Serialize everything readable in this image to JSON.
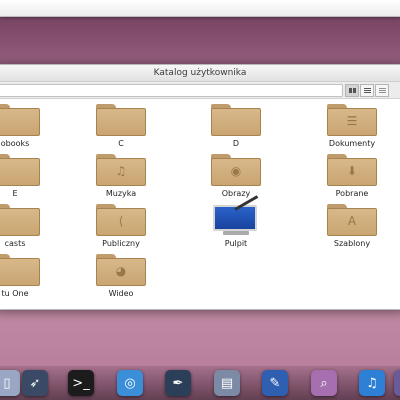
{
  "window": {
    "title": "Katalog użytkownika"
  },
  "folders": [
    {
      "label": "obooks",
      "emblem": ""
    },
    {
      "label": "C",
      "emblem": ""
    },
    {
      "label": "D",
      "emblem": ""
    },
    {
      "label": "Dokumenty",
      "emblem": "☰"
    },
    {
      "label": "E",
      "emblem": ""
    },
    {
      "label": "Muzyka",
      "emblem": "♫"
    },
    {
      "label": "Obrazy",
      "emblem": "◉"
    },
    {
      "label": "Pobrane",
      "emblem": "⬇"
    },
    {
      "label": "casts",
      "emblem": ""
    },
    {
      "label": "Publiczny",
      "emblem": "⟨"
    },
    {
      "label": "Pulpit",
      "emblem": ""
    },
    {
      "label": "Szablony",
      "emblem": "A"
    },
    {
      "label": "tu One",
      "emblem": ""
    },
    {
      "label": "Wideo",
      "emblem": "◕"
    }
  ],
  "dock": [
    {
      "name": "file-icon",
      "glyph": "▯",
      "color": "#9aa7c4"
    },
    {
      "name": "rocket-icon",
      "glyph": "➶",
      "color": "#3a4a66"
    },
    {
      "name": "terminal-icon",
      "glyph": ">_",
      "color": "#1c1c1c"
    },
    {
      "name": "network-icon",
      "glyph": "◎",
      "color": "#3a8fd8"
    },
    {
      "name": "tools-icon",
      "glyph": "✒",
      "color": "#2b3f58"
    },
    {
      "name": "documents-icon",
      "glyph": "▤",
      "color": "#7d8aa5"
    },
    {
      "name": "quill-icon",
      "glyph": "✎",
      "color": "#2f5fb0"
    },
    {
      "name": "search-icon",
      "glyph": "⌕",
      "color": "#a66fb0"
    },
    {
      "name": "music-icon",
      "glyph": "♫",
      "color": "#2e7fd6"
    },
    {
      "name": "app-icon",
      "glyph": "◆",
      "color": "#6a5a9a"
    }
  ]
}
